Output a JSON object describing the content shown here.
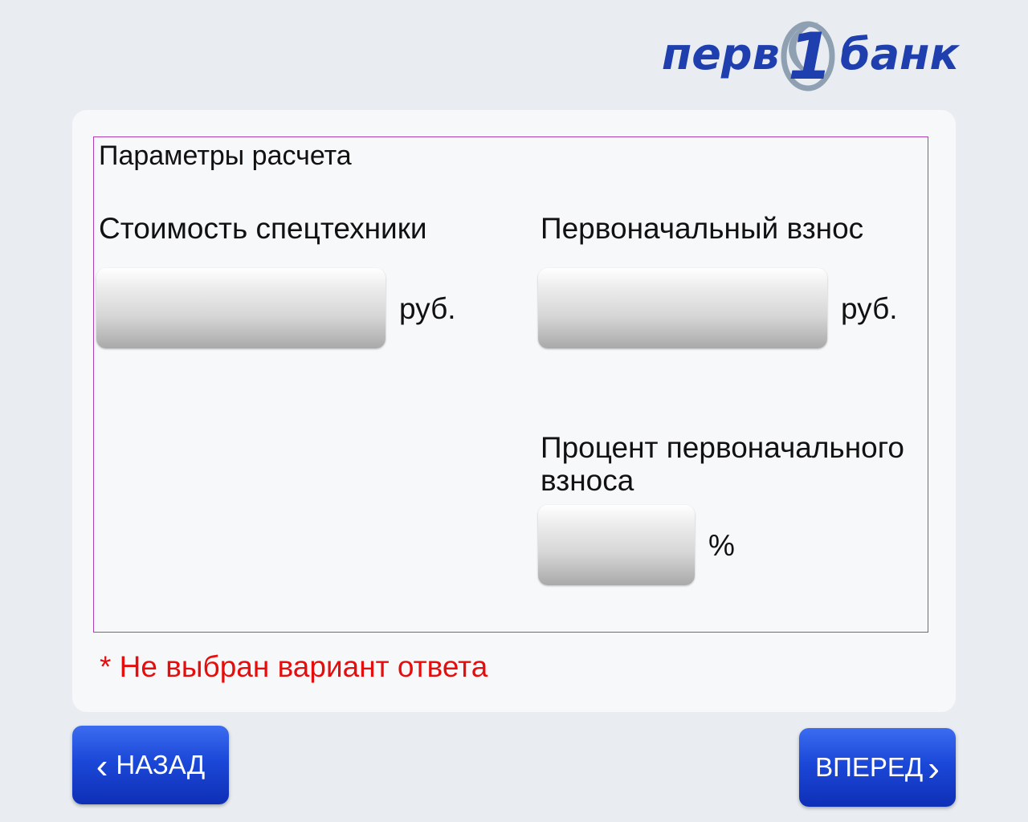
{
  "brand": {
    "name": "ПЕРВОБАНК",
    "logo_left": "перв",
    "logo_digit": "1",
    "logo_right": "банк",
    "colors": {
      "primary": "#1f3fae",
      "secondary": "#8fa0b3"
    }
  },
  "form": {
    "section_title": "Параметры расчета",
    "fields": {
      "equipment_cost": {
        "label": "Стоимость спецтехники",
        "value": "",
        "unit": "руб."
      },
      "down_payment": {
        "label": "Первоначальный взнос",
        "value": "",
        "unit": "руб."
      },
      "down_payment_percent": {
        "label": "Процент первоначального взноса",
        "value": "",
        "unit": "%"
      }
    },
    "error_message": "* Не выбран вариант ответа",
    "colors": {
      "frame": "#b03fb5",
      "error": "#e60d0d"
    }
  },
  "navigation": {
    "back_label": "НАЗАД",
    "back_icon": "chevron-left-icon",
    "forward_label": "ВПЕРЕД",
    "forward_icon": "chevron-right-icon",
    "button_color": "#1b48d8"
  }
}
